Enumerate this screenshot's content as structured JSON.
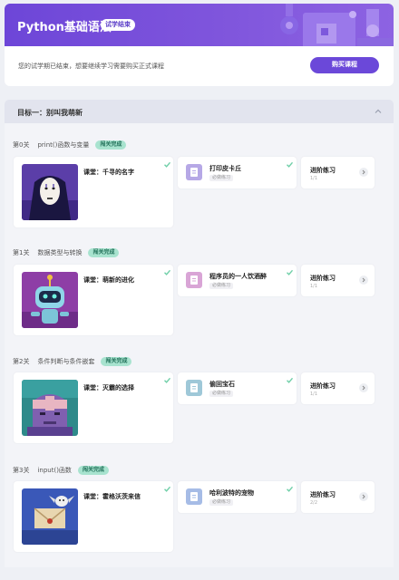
{
  "header": {
    "title": "Python基础语法",
    "badge": "试学结束"
  },
  "notice": {
    "text": "您的试学期已结束，想要继续学习需要购买正式课程",
    "buy_label": "购买课程"
  },
  "goal": {
    "label": "目标一：别叫我萌新"
  },
  "levels": [
    {
      "num": "第0关",
      "name": "print()函数与变量",
      "status": "闯关完成",
      "lesson": "课堂：千寻的名字",
      "exercise": "打印皮卡丘",
      "exercise_tag": "必做练习",
      "advanced": "进阶练习",
      "advanced_count": "1/1"
    },
    {
      "num": "第1关",
      "name": "数据类型与转换",
      "status": "闯关完成",
      "lesson": "课堂：萌新的进化",
      "exercise": "程序员的一人饮酒醉",
      "exercise_tag": "必做练习",
      "advanced": "进阶练习",
      "advanced_count": "1/1"
    },
    {
      "num": "第2关",
      "name": "条件判断与条件嵌套",
      "status": "闯关完成",
      "lesson": "课堂：灭霸的选择",
      "exercise": "偷回宝石",
      "exercise_tag": "必做练习",
      "advanced": "进阶练习",
      "advanced_count": "1/1"
    },
    {
      "num": "第3关",
      "name": "input()函数",
      "status": "闯关完成",
      "lesson": "课堂：霍格沃茨来信",
      "exercise": "哈利波特的宠物",
      "exercise_tag": "必做练习",
      "advanced": "进阶练习",
      "advanced_count": "2/2"
    }
  ],
  "colors": {
    "accent": "#6b48d9",
    "pass_badge": "#a8e3cf",
    "check": "#6fcfa8"
  },
  "icons": {
    "check": "check-icon",
    "chevron_up": "chevron-up-icon",
    "chevron_right": "chevron-right-icon",
    "exercise": "code-file-icon"
  }
}
